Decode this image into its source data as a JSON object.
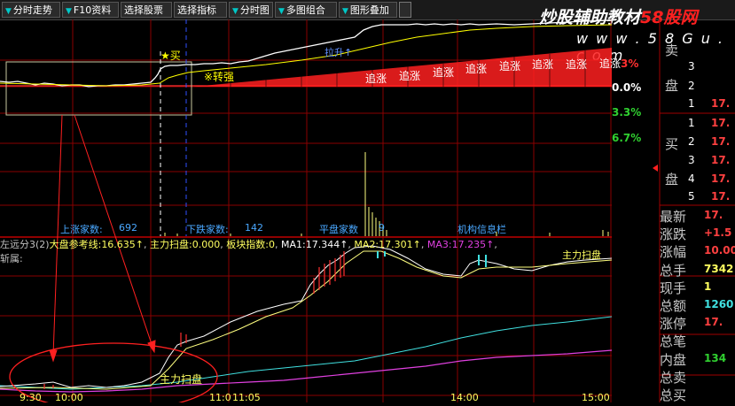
{
  "toolbar": {
    "items": [
      {
        "label": "分时走势"
      },
      {
        "label": "F10资料"
      },
      {
        "label": "选择股票"
      },
      {
        "label": "选择指标"
      },
      {
        "label": "分时图"
      },
      {
        "label": "多图组合"
      },
      {
        "label": "图形叠加"
      }
    ]
  },
  "watermark": {
    "main": "炒股辅助教材",
    "brand": "58股网",
    "url": "w w w . 5 8 G u . c o m"
  },
  "price_chart": {
    "buy_label": "★买",
    "turn_strong": "※转强",
    "pull_up": "拉升↑",
    "chase_label": "追涨",
    "chase_count": 8,
    "pct_labels": [
      "3%",
      "0.0%",
      "3.3%",
      "6.7%"
    ],
    "pct_colors": [
      "#ff3030",
      "#ffffff",
      "#30d030",
      "#30d030"
    ]
  },
  "stats": {
    "up_count_label": "上涨家数:",
    "up_count": "692",
    "down_count_label": "下跌家数:",
    "down_count": "142",
    "flat_label": "平盘家数",
    "flat_count": "9",
    "inst_label": "机构信息栏"
  },
  "indicator": {
    "name": "主力扫盘",
    "line_prefix": "左远分3(2)",
    "market_ref_label": "大盘参考线:",
    "market_ref": "16.635↑",
    "sweep_label": "主力扫盘:",
    "sweep": "0.000",
    "sector_label": "板块指数:",
    "sector": "0",
    "ma1_label": "MA1:",
    "ma1": "17.344↑",
    "ma2_label": "MA2:",
    "ma2": "17.301↑",
    "ma3_label": "MA3:",
    "ma3": "17.235↑",
    "sub_line": "斩属:",
    "sweep_annotation": "主力扫盘"
  },
  "time_axis": [
    "9:30",
    "10:00",
    "11:0",
    "11:05",
    "14:00",
    "15:00"
  ],
  "quote_panel": {
    "sell_label_chars": [
      "卖",
      "盘"
    ],
    "buy_label_chars": [
      "买",
      "盘"
    ],
    "sell_rows": [
      {
        "n": "3",
        "v": ""
      },
      {
        "n": "2",
        "v": ""
      },
      {
        "n": "1",
        "v": "17."
      }
    ],
    "buy_rows": [
      {
        "n": "1",
        "v": "17."
      },
      {
        "n": "2",
        "v": "17."
      },
      {
        "n": "3",
        "v": "17."
      },
      {
        "n": "4",
        "v": "17."
      },
      {
        "n": "5",
        "v": "17."
      }
    ],
    "fields": [
      {
        "label": "最新",
        "value": "17.",
        "color": "#ff4040"
      },
      {
        "label": "涨跌",
        "value": "+1.5",
        "color": "#ff4040"
      },
      {
        "label": "涨幅",
        "value": "10.00",
        "color": "#ff4040"
      },
      {
        "label": "总手",
        "value": "7342",
        "color": "#ffff60"
      },
      {
        "label": "现手",
        "value": "1",
        "color": "#ffff60"
      },
      {
        "label": "总额",
        "value": "1260",
        "color": "#40e0e0"
      },
      {
        "label": "涨停",
        "value": "17.",
        "color": "#ff4040"
      },
      {
        "label": "总笔",
        "value": "",
        "color": "#ffffff"
      },
      {
        "label": "内盘",
        "value": "134",
        "color": "#30d030"
      },
      {
        "label": "总卖",
        "value": "",
        "color": "#ffffff"
      },
      {
        "label": "总买",
        "value": "",
        "color": "#ffffff"
      }
    ]
  },
  "colors": {
    "grid": "#a00000",
    "price": "#ffffff",
    "avg": "#ffff00",
    "cyan": "#40e0e0",
    "magenta": "#e040e0",
    "red": "#ff2020"
  }
}
